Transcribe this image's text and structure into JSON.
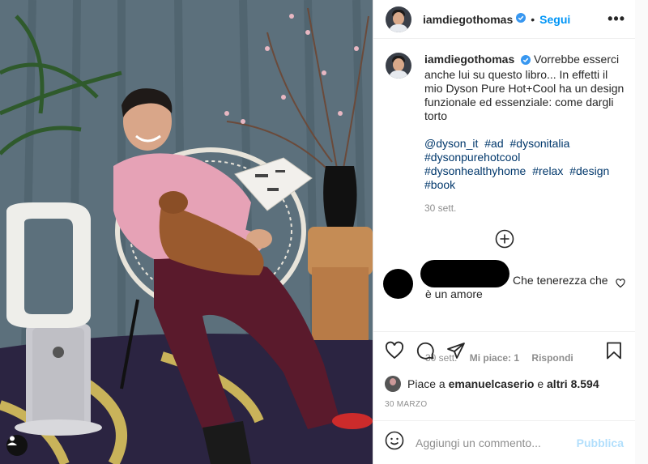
{
  "post": {
    "username": "iamdiegothomas",
    "follow_label": "Segui",
    "separator": "•",
    "more_label": "•••"
  },
  "caption": {
    "username": "iamdiegothomas",
    "text": "Vorrebbe esserci anche lui su questo libro... In effetti il mio Dyson Pure Hot+Cool ha un design funzionale ed essenziale: come dargli torto",
    "tags": [
      "@dyson_it",
      "#ad",
      "#dysonitalia",
      "#dysonpurehotcool",
      "#dysonhealthyhome",
      "#relax",
      "#design",
      "#book"
    ],
    "time": "30 sett."
  },
  "reply": {
    "text": "Che tenerezza che è un amore",
    "time": "30 sett.",
    "likes": "Mi piace: 1",
    "reply_label": "Rispondi"
  },
  "likes": {
    "prefix": "Piace a",
    "user": "emanuelcaserio",
    "connector": "e",
    "others": "altri 8.594"
  },
  "date": "30 MARZO",
  "add_comment": {
    "placeholder": "Aggiungi un commento...",
    "publish_label": "Pubblica"
  },
  "icons": [
    "heart-icon",
    "comment-icon",
    "share-icon",
    "bookmark-icon",
    "verified-icon",
    "plus-circle-icon",
    "emoji-icon"
  ],
  "colors": {
    "link": "#00376b",
    "follow": "#0095f6",
    "muted": "#8e8e8e",
    "publish_disabled": "#b2dffc"
  }
}
